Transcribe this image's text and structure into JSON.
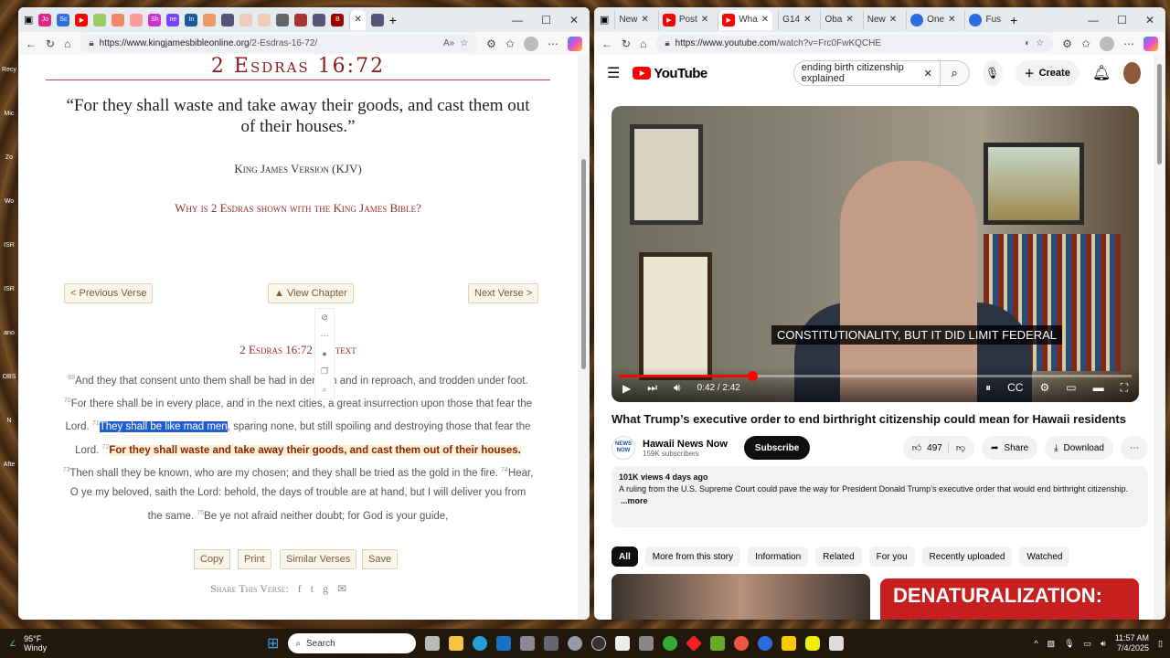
{
  "desktop": {
    "icons": [
      "Recy",
      "Mic",
      "Zo",
      "Wo",
      "ISR",
      "ISR",
      "ano",
      "OBS",
      "N",
      "Afte"
    ]
  },
  "left_browser": {
    "tabs": [
      "Jo",
      "Sc",
      "",
      "",
      "",
      "",
      "Sh",
      "ne",
      "In",
      "",
      "",
      "",
      "",
      "",
      "",
      "",
      "",
      ""
    ],
    "url_host": "https://www.kingjamesbibleonline.org",
    "url_path": "/2-Esdras-16-72/",
    "page": {
      "title": "2 Esdras 16:72",
      "quote": "“For they shall waste and take away their goods, and cast them out of their houses.”",
      "version": "King James Version (KJV)",
      "why_link": "Why is 2 Esdras shown with the King James Bible?",
      "prev": "< Previous Verse",
      "chapter": "▲ View Chapter",
      "next": "Next Verse >",
      "context_title": "2 Esdras 16:72 Context",
      "verses": [
        {
          "n": "69",
          "t": "And they that consent unto them shall be had in derision and in reproach, and trodden under foot. "
        },
        {
          "n": "70",
          "t": "For there shall be in every place, and in the next cities, a great insurrection upon those that fear the Lord. "
        },
        {
          "n": "71",
          "sel": "They shall be like mad men",
          "t": ", sparing none, but still spoiling and destroying those that fear the Lord. "
        },
        {
          "n": "72",
          "t": "For they shall waste and take away their goods, and cast them out of their houses."
        },
        {
          "n": "73",
          "t": "Then shall they be known, who are my chosen; and they shall be tried as the gold in the fire. "
        },
        {
          "n": "74",
          "t": "Hear, O ye my beloved, saith the Lord: behold, the days of trouble are at hand, but I will deliver you from the same. "
        },
        {
          "n": "75",
          "t": "Be ye not afraid neither doubt; for God is your guide,"
        }
      ],
      "actions": [
        "Copy",
        "Print",
        "Similar Verses",
        "Save"
      ],
      "share_label": "Share This Verse:"
    }
  },
  "right_browser": {
    "tabs": [
      "New",
      "Post",
      "Wha",
      "G14",
      "Oba",
      "New",
      "One",
      "Fus"
    ],
    "url_host": "https://www.youtube.com",
    "url_path": "/watch?v=Frc0FwKQCHE",
    "youtube": {
      "logo": "YouTube",
      "search_value": "ending birth citizenship explained",
      "create": "Create",
      "caption": "CONSTITUTIONALITY, BUT IT DID LIMIT FEDERAL",
      "time": "0:42 / 2:42",
      "progress": 0.26,
      "video_title": "What Trump’s executive order to end birthright citizenship could mean for Hawaii residents",
      "channel": "Hawaii News Now",
      "channel_logo": "NEWS NOW",
      "subscribers": "159K subscribers",
      "subscribe": "Subscribe",
      "likes": "497",
      "share": "Share",
      "download": "Download",
      "views_date": "101K views  4 days ago",
      "description": "A ruling from the U.S. Supreme Court could pave the way for President Donald Trump’s executive order that would end birthright citizenship.",
      "more": "...more",
      "chips": [
        "All",
        "More from this story",
        "Information",
        "Related",
        "For you",
        "Recently uploaded",
        "Watched"
      ],
      "thumb_text": "DENATURALIZATION:"
    }
  },
  "taskbar": {
    "temp": "95°F",
    "weather": "Windy",
    "search": "Search",
    "time": "11:57 AM",
    "date": "7/4/2025"
  }
}
